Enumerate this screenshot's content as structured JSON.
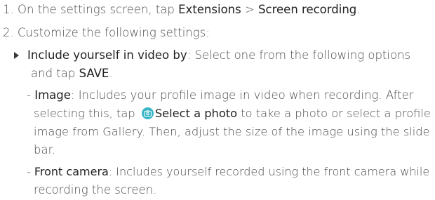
{
  "steps": {
    "s1_num": "1.",
    "s1_pre": "On the settings screen, tap ",
    "s1_b1": "Extensions",
    "s1_mid": " > ",
    "s1_b2": "Screen recording",
    "s1_post": ".",
    "s2_num": "2.",
    "s2_text": "Customize the following settings:"
  },
  "bullet": {
    "label": "Include yourself in video by",
    "text_l1": ": Select one from the following options",
    "text_l2_pre": "and tap ",
    "save": "SAVE",
    "text_l2_post": "."
  },
  "image_option": {
    "dash": "- ",
    "label": "Image",
    "l1_text": ": Includes your profile image in video when recording. After",
    "l2_pre": "selecting this, tap ",
    "icon": "camera-icon",
    "select_photo": "Select a photo",
    "l2_post": " to take a photo or select a profile",
    "l3": "image from Gallery. Then, adjust the size of the image using the slide",
    "l4": "bar."
  },
  "front_option": {
    "dash": "- ",
    "label": "Front camera",
    "l1_text": ": Includes yourself recorded using the front camera while",
    "l2": "recording the screen."
  },
  "colors": {
    "icon_bg": "#39b6c6",
    "text": "#4a4a4a",
    "bold_text": "#222222"
  }
}
